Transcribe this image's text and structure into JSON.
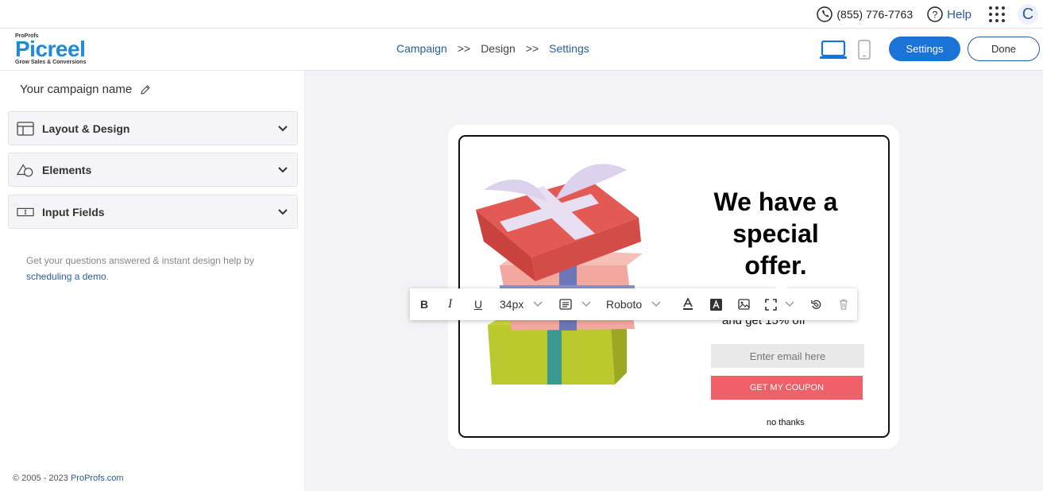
{
  "topbar": {
    "phone": "(855) 776-7763",
    "help": "Help",
    "avatar_letter": "C"
  },
  "header": {
    "logo": {
      "brand_small": "ProProfs",
      "name": "Picreel",
      "tagline": "Grow Sales & Conversions"
    },
    "breadcrumb": [
      "Campaign",
      ">>",
      "Design",
      ">>",
      "Settings"
    ],
    "settings_label": "Settings",
    "done_label": "Done"
  },
  "sidebar": {
    "campaign_name": "Your campaign name",
    "panels": [
      {
        "label": "Layout & Design"
      },
      {
        "label": "Elements"
      },
      {
        "label": "Input Fields"
      }
    ],
    "help_text": "Get your questions answered & instant design help by",
    "help_link": "scheduling a demo",
    "help_end": ".",
    "footer_text": "© 2005 - 2023",
    "footer_link": "ProProfs.com"
  },
  "toolbar": {
    "font_size": "34px",
    "font_family": "Roboto"
  },
  "popup": {
    "headline": "We have a special offer.",
    "subtext": "and get 15% off",
    "email_placeholder": "Enter email here",
    "cta": "GET MY COUPON",
    "dismiss": "no thanks"
  },
  "colors": {
    "accent": "#1a73d6",
    "cta": "#f06068",
    "brand": "#1f8ad6"
  }
}
